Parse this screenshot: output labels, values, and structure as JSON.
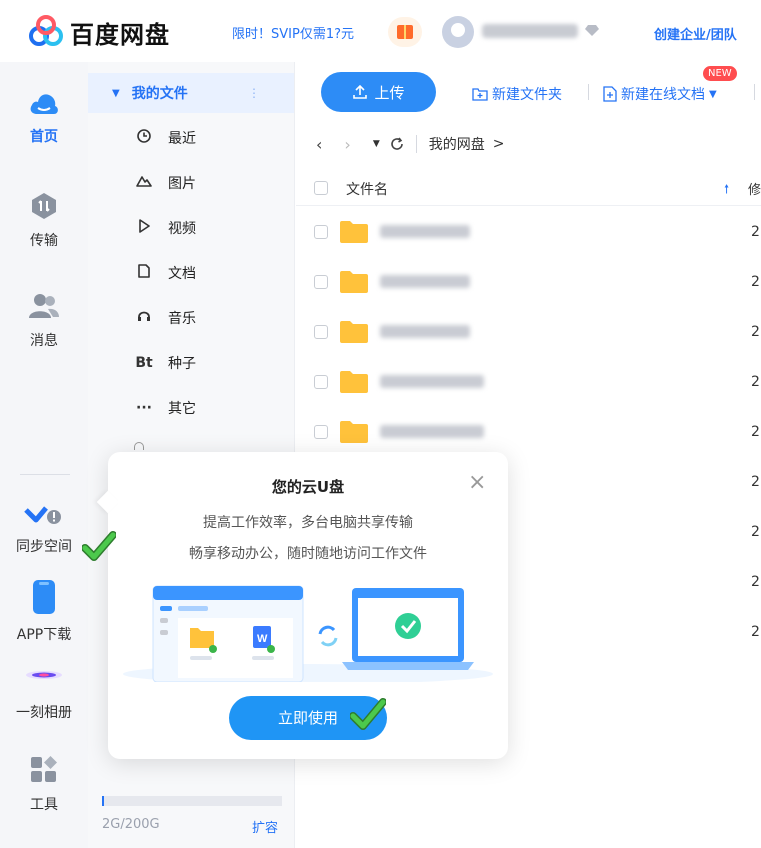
{
  "app": {
    "brand": "百度网盘",
    "promo": "限时！SVIP仅需1?元",
    "enterprise_link": "创建企业/团队"
  },
  "leftnav": {
    "items": [
      {
        "label": "首页",
        "icon": "cloud-home-icon"
      },
      {
        "label": "传输",
        "icon": "transfer-icon"
      },
      {
        "label": "消息",
        "icon": "contacts-icon"
      },
      {
        "label": "同步空间",
        "icon": "sync-space-icon"
      },
      {
        "label": "APP下载",
        "icon": "phone-icon"
      },
      {
        "label": "一刻相册",
        "icon": "album-icon"
      },
      {
        "label": "工具",
        "icon": "tools-icon"
      }
    ]
  },
  "sidebar": {
    "my_files": "我的文件",
    "items": [
      {
        "label": "最近",
        "icon": "clock-icon"
      },
      {
        "label": "图片",
        "icon": "image-icon"
      },
      {
        "label": "视频",
        "icon": "play-icon"
      },
      {
        "label": "文档",
        "icon": "document-icon"
      },
      {
        "label": "音乐",
        "icon": "headphones-icon"
      },
      {
        "label": "种子",
        "icon": "bt-icon",
        "glyph": "Bt"
      },
      {
        "label": "其它",
        "icon": "more-icon",
        "glyph": "···"
      }
    ],
    "storage": "2G/200G",
    "storage_fraction": 0.01,
    "expand": "扩容"
  },
  "toolbar": {
    "upload": "上传",
    "new_folder": "新建文件夹",
    "new_online_doc": "新建在线文档",
    "new_badge": "NEW"
  },
  "breadcrumb": {
    "root": "我的网盘",
    "sep": ">"
  },
  "filelist": {
    "header_name": "文件名",
    "header_col2": "修",
    "rows_col2": [
      "2",
      "2",
      "2",
      "2",
      "2",
      "2",
      "2",
      "2",
      "2"
    ]
  },
  "popup": {
    "title": "您的云U盘",
    "line1": "提高工作效率，多台电脑共享传输",
    "line2": "畅享移动办公，随时随地访问工作文件",
    "button": "立即使用"
  },
  "colors": {
    "accent": "#2573f5",
    "button": "#1f95f5",
    "check": "#3bb54a",
    "folder": "#ffc23b"
  }
}
